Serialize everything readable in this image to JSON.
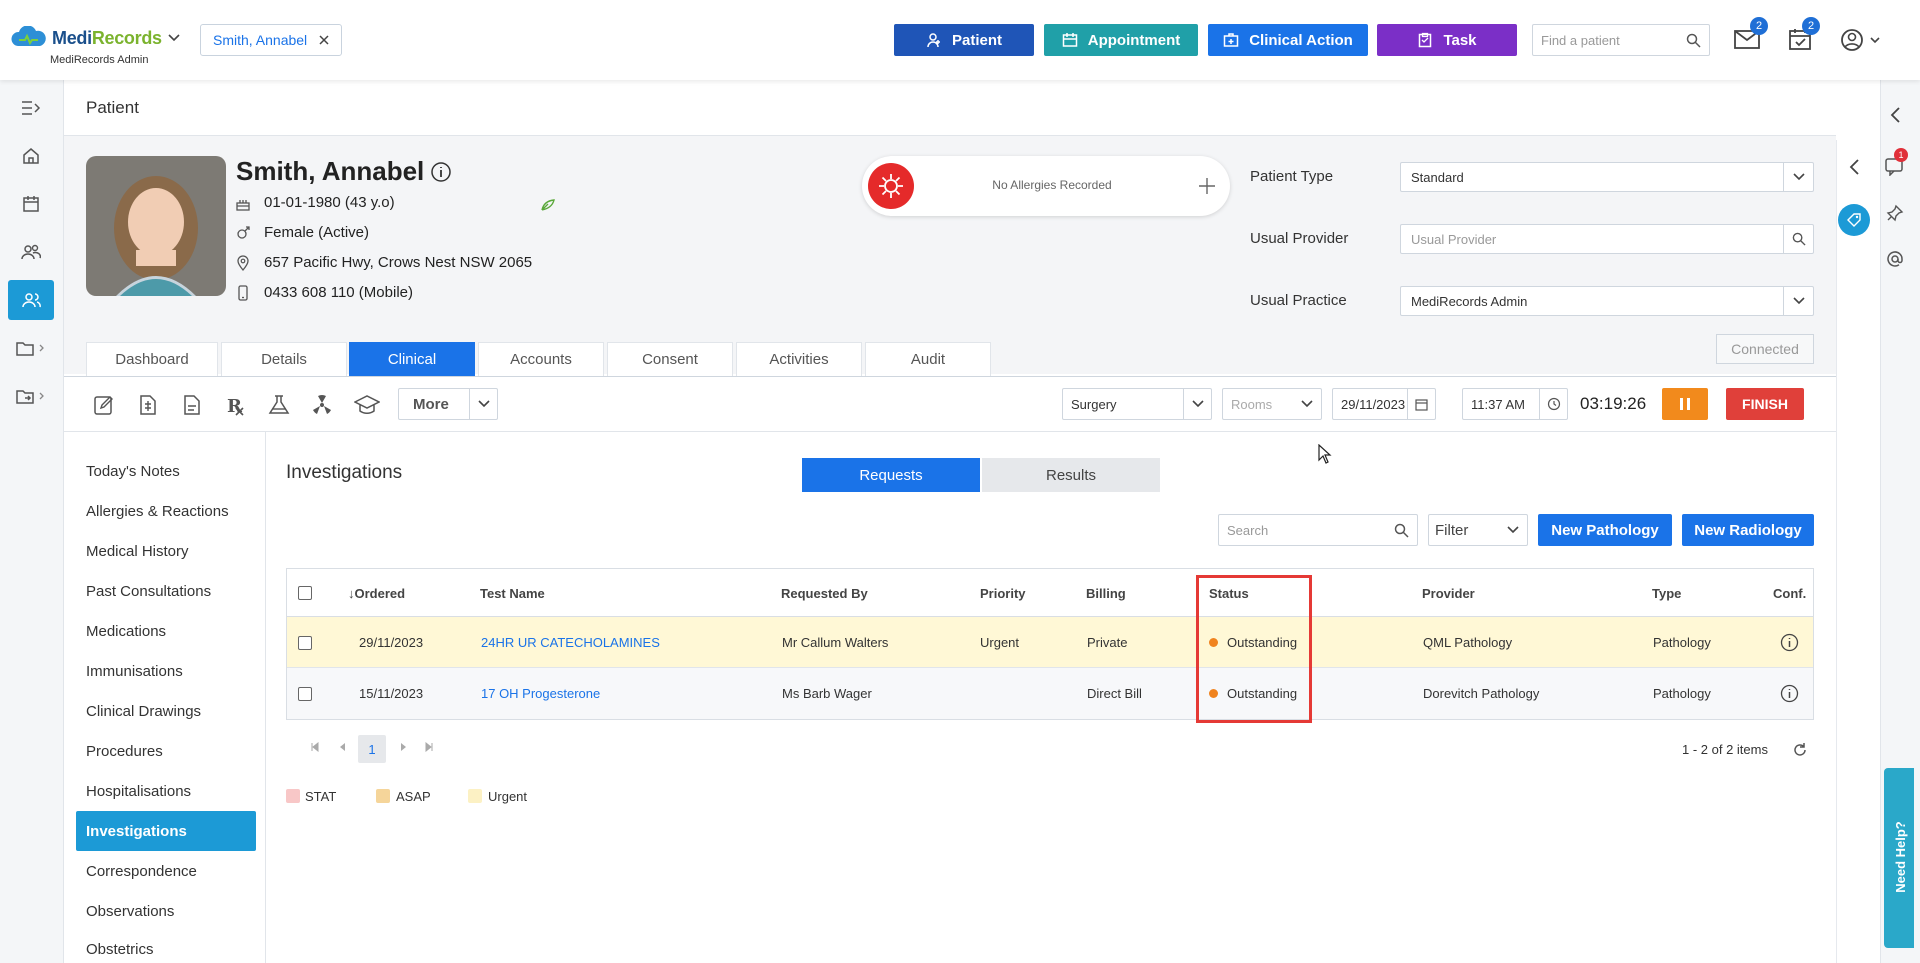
{
  "colors": {
    "primary": "#1a73e8",
    "teal": "#20a0a8",
    "purple": "#7b2fc7",
    "navy": "#1f55b7",
    "finish": "#e0403a",
    "pause": "#f28a1c",
    "status_dot": "#f0831e",
    "highlight_row": "#fff8d6",
    "stat": "#f8c7c7",
    "asap": "#f5d59a",
    "urgent": "#fcf1c4"
  },
  "header": {
    "logo": "MediRecords",
    "logo_brand_a": "Medi",
    "logo_brand_b": "Records",
    "org": "MediRecords Admin",
    "patient_chip": "Smith, Annabel",
    "buttons": {
      "patient": "Patient",
      "appointment": "Appointment",
      "clinical_action": "Clinical Action",
      "task": "Task"
    },
    "search_placeholder": "Find a patient",
    "mail_count": "2",
    "tasks_count": "2"
  },
  "page": {
    "title": "Patient"
  },
  "patient": {
    "name": "Smith, Annabel",
    "dob": "01-01-1980 (43 y.o)",
    "gender": "Female (Active)",
    "address": "657 Pacific Hwy, Crows Nest NSW 2065",
    "phone": "0433 608 110 (Mobile)"
  },
  "allergies": {
    "text": "No Allergies Recorded"
  },
  "fields": {
    "patient_type_label": "Patient Type",
    "patient_type_value": "Standard",
    "usual_provider_label": "Usual Provider",
    "usual_provider_placeholder": "Usual Provider",
    "usual_practice_label": "Usual Practice",
    "usual_practice_value": "MediRecords Admin",
    "connected": "Connected"
  },
  "tabs": [
    "Dashboard",
    "Details",
    "Clinical",
    "Accounts",
    "Consent",
    "Activities",
    "Audit"
  ],
  "toolbar": {
    "more": "More",
    "location": "Surgery",
    "rooms_placeholder": "Rooms",
    "date": "29/11/2023",
    "time": "11:37 AM",
    "timer": "03:19:26",
    "finish": "FINISH"
  },
  "nav": [
    "Today's Notes",
    "Allergies & Reactions",
    "Medical History",
    "Past Consultations",
    "Medications",
    "Immunisations",
    "Clinical Drawings",
    "Procedures",
    "Hospitalisations",
    "Investigations",
    "Correspondence",
    "Observations",
    "Obstetrics"
  ],
  "investigations": {
    "title": "Investigations",
    "seg_requests": "Requests",
    "seg_results": "Results",
    "search_placeholder": "Search",
    "filter": "Filter",
    "new_pathology": "New Pathology",
    "new_radiology": "New Radiology",
    "columns": {
      "ordered": "Ordered",
      "ordered_arrow": "↓",
      "test": "Test Name",
      "requested_by": "Requested By",
      "priority": "Priority",
      "billing": "Billing",
      "status": "Status",
      "provider": "Provider",
      "type": "Type",
      "conf": "Conf."
    },
    "rows": [
      {
        "ordered": "29/11/2023",
        "test": "24HR UR CATECHOLAMINES",
        "requested_by": "Mr Callum Walters",
        "priority": "Urgent",
        "billing": "Private",
        "status": "Outstanding",
        "provider": "QML Pathology",
        "type": "Pathology"
      },
      {
        "ordered": "15/11/2023",
        "test": "17 OH Progesterone",
        "requested_by": "Ms Barb Wager",
        "priority": "",
        "billing": "Direct Bill",
        "status": "Outstanding",
        "provider": "Dorevitch Pathology",
        "type": "Pathology"
      }
    ],
    "page": "1",
    "items": "1 - 2 of 2 items",
    "legend": {
      "stat": "STAT",
      "asap": "ASAP",
      "urgent": "Urgent"
    }
  },
  "help": {
    "label": "Need Help?"
  },
  "notifications": {
    "side_badge": "1"
  }
}
